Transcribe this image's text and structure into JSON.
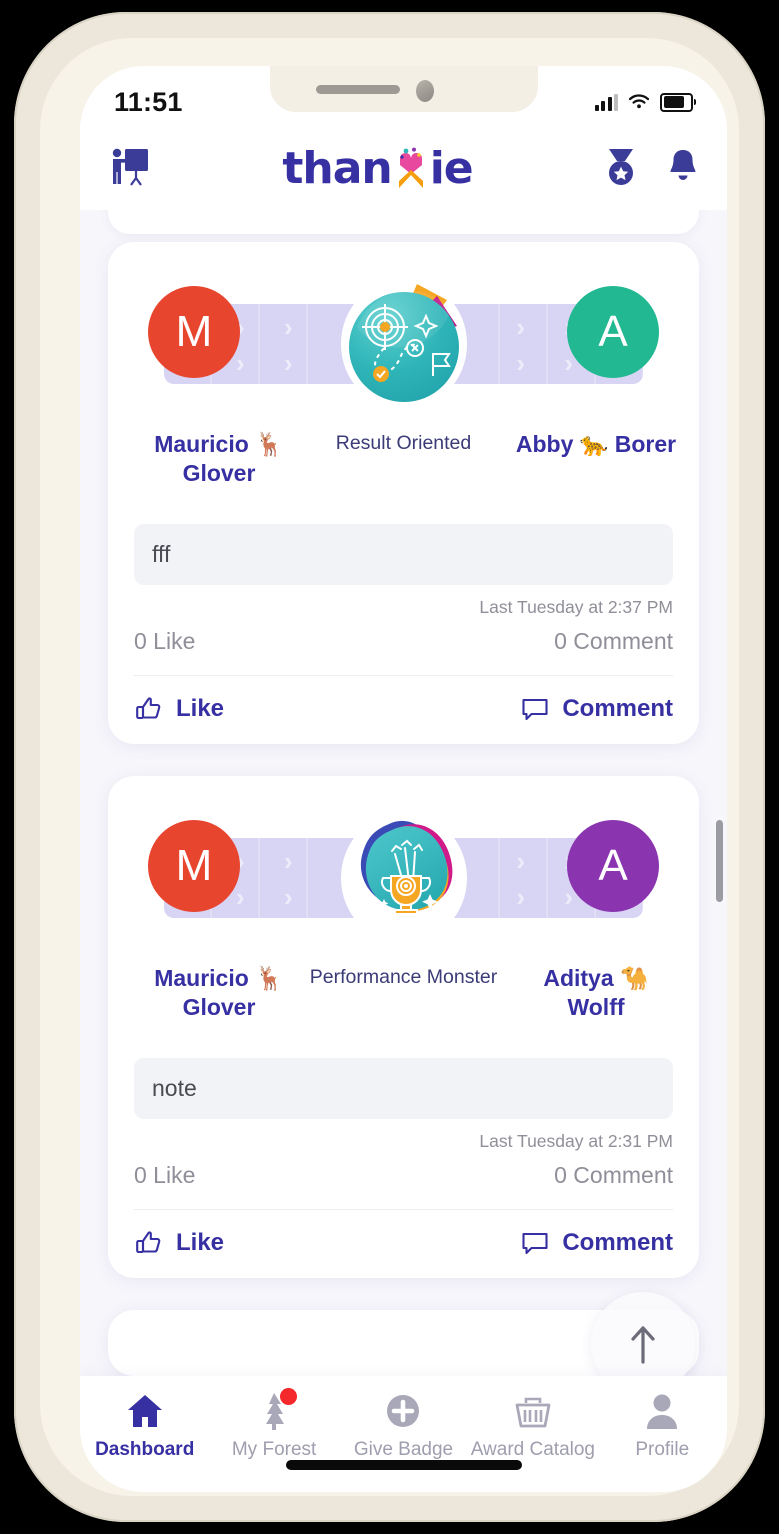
{
  "status_bar": {
    "time": "11:51",
    "signal_icon": "cellular-signal-icon",
    "wifi_icon": "wifi-icon",
    "battery_icon": "battery-icon"
  },
  "header": {
    "left_icon": "presentation-board-icon",
    "logo_text_before": "than",
    "logo_x": "x",
    "logo_text_after": "ie",
    "logo_name": "thanxie",
    "medal_icon": "medal-star-icon",
    "bell_icon": "notification-bell-icon",
    "brand_color": "#3730a3",
    "logo_x_top_color": "#e8489e",
    "logo_x_bottom_color": "#f59e0b"
  },
  "feed": {
    "cards": [
      {
        "giver": {
          "initial": "M",
          "name": "Mauricio 🦌 Glover",
          "name_line1": "Mauricio 🦌",
          "name_line2": "Glover",
          "avatar_color": "#e8452f"
        },
        "receiver": {
          "initial": "A",
          "name": "Abby 🐆 Borer",
          "name_line1": "Abby 🐆 Borer",
          "name_line2": "",
          "avatar_color": "#22b892"
        },
        "award": {
          "title": "Result Oriented",
          "icon": "target-journey-badge-icon",
          "shape": "circle",
          "badge_color": "#2fb5b8",
          "accent_1": "#f5a623",
          "accent_2": "#c2188c"
        },
        "note": "fff",
        "timestamp": "Last Tuesday at 2:37 PM",
        "like_count": "0 Like",
        "comment_count": "0 Comment",
        "like_label": "Like",
        "comment_label": "Comment",
        "like_icon": "thumbs-up-icon",
        "comment_icon": "comment-bubble-icon"
      },
      {
        "giver": {
          "initial": "M",
          "name": "Mauricio 🦌 Glover",
          "name_line1": "Mauricio 🦌",
          "name_line2": "Glover",
          "avatar_color": "#e8452f"
        },
        "receiver": {
          "initial": "A",
          "name": "Aditya 🐪 Wolff",
          "name_line1": "Aditya 🐪",
          "name_line2": "Wolff",
          "avatar_color": "#8b34b0"
        },
        "award": {
          "title": "Performance Monster",
          "icon": "trophy-arrows-badge-icon",
          "shape": "blob",
          "badge_color": "#2fb5b8",
          "accent_1": "#3b4bb5",
          "accent_2": "#d11a8a",
          "accent_3": "#f5a623"
        },
        "note": "note",
        "timestamp": "Last Tuesday at 2:31 PM",
        "like_count": "0 Like",
        "comment_count": "0 Comment",
        "like_label": "Like",
        "comment_label": "Comment",
        "like_icon": "thumbs-up-icon",
        "comment_icon": "comment-bubble-icon"
      }
    ]
  },
  "scroll_top_button": {
    "icon": "arrow-up-icon",
    "label": ""
  },
  "bottom_nav": {
    "active_index": 0,
    "items": [
      {
        "label": "Dashboard",
        "icon": "home-icon",
        "badge": false
      },
      {
        "label": "My Forest",
        "icon": "tree-icon",
        "badge": true
      },
      {
        "label": "Give Badge",
        "icon": "plus-circle-icon",
        "badge": false
      },
      {
        "label": "Award Catalog",
        "icon": "basket-icon",
        "badge": false
      },
      {
        "label": "Profile",
        "icon": "person-icon",
        "badge": false
      }
    ]
  }
}
